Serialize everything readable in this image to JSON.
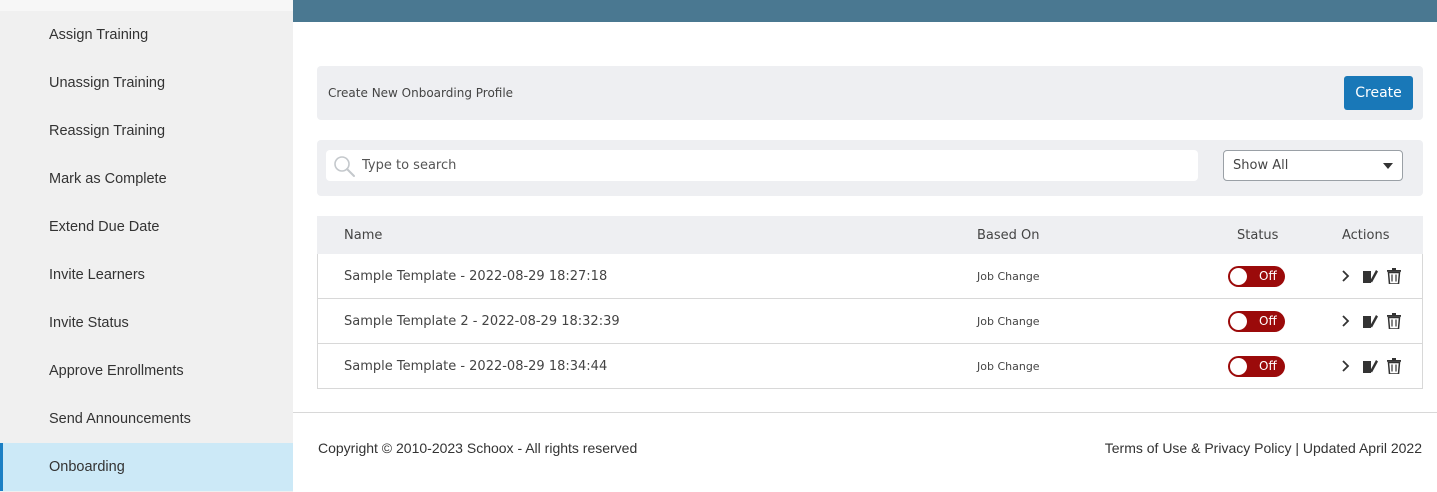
{
  "sidebar": {
    "items": [
      {
        "label": "Assign Training"
      },
      {
        "label": "Unassign Training"
      },
      {
        "label": "Reassign Training"
      },
      {
        "label": "Mark as Complete"
      },
      {
        "label": "Extend Due Date"
      },
      {
        "label": "Invite Learners"
      },
      {
        "label": "Invite Status"
      },
      {
        "label": "Approve Enrollments"
      },
      {
        "label": "Send Announcements"
      },
      {
        "label": "Onboarding"
      }
    ],
    "active_index": 9
  },
  "create_panel": {
    "label": "Create New Onboarding Profile",
    "button_label": "Create"
  },
  "filter": {
    "search_placeholder": "Type to search",
    "select_value": "Show All"
  },
  "table": {
    "headers": {
      "name": "Name",
      "based_on": "Based On",
      "status": "Status",
      "actions": "Actions"
    },
    "rows": [
      {
        "name": "Sample Template - 2022-08-29 18:27:18",
        "based_on": "Job Change",
        "status": "Off"
      },
      {
        "name": "Sample Template 2 - 2022-08-29 18:32:39",
        "based_on": "Job Change",
        "status": "Off"
      },
      {
        "name": "Sample Template - 2022-08-29 18:34:44",
        "based_on": "Job Change",
        "status": "Off"
      }
    ]
  },
  "footer": {
    "copyright": "Copyright © 2010-2023 Schoox - All rights reserved",
    "terms": "Terms of Use",
    "amp": " & ",
    "privacy": "Privacy Policy",
    "updated": " | Updated April 2022"
  },
  "colors": {
    "topbar": "#4a7891",
    "accent": "#1978b8",
    "toggle_off": "#9b0a0a",
    "active_item": "#cce9f7"
  }
}
